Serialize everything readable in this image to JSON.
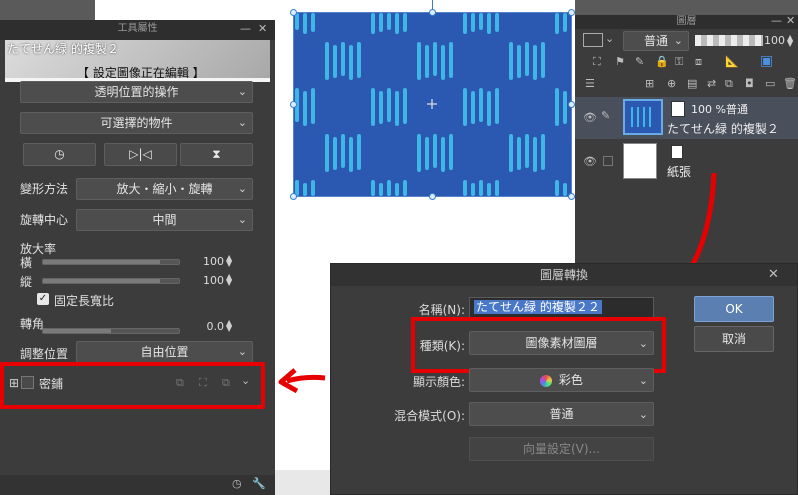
{
  "tool_panel": {
    "title": "工具屬性",
    "subtool_name": "たてせん緑 的複製２",
    "status": "【 設定圖像正在編輯 】",
    "transparent_pos_op": "透明位置的操作",
    "selectable_obj": "可選擇的物件",
    "transform_method_label": "變形方法",
    "transform_method_value": "放大・縮小・旋轉",
    "rotation_center_label": "旋轉中心",
    "rotation_center_value": "中間",
    "scale_label": "放大率",
    "horizontal_label": "橫",
    "horizontal_value": "100",
    "vertical_label": "縱",
    "vertical_value": "100",
    "fixed_ratio_label": "固定長寬比",
    "rotation_label": "轉角",
    "rotation_value": "0.0",
    "adjust_pos_label": "調整位置",
    "adjust_pos_value": "自由位置",
    "tile_label": "密鋪"
  },
  "layer_panel": {
    "title": "圖層",
    "blend_mode": "普通",
    "opacity": "100",
    "layer1_info": "100 %普通",
    "layer1_name": "たてせん緑 的複製２",
    "layer2_name": "紙張"
  },
  "dialog": {
    "title": "圖層轉換",
    "name_label": "名稱(N):",
    "name_value": "たてせん緑 的複製２２",
    "type_label": "種類(K):",
    "type_value": "圖像素材圖層",
    "color_label": "顯示顏色:",
    "color_value": "彩色",
    "blend_label": "混合模式(O):",
    "blend_value": "普通",
    "vector_btn": "向量設定(V)...",
    "ok": "OK",
    "cancel": "取消"
  },
  "colors": {
    "canvas_blue": "#2b58b0",
    "stripe_cyan": "#3fb6e6",
    "annotation_red": "#e60000"
  }
}
